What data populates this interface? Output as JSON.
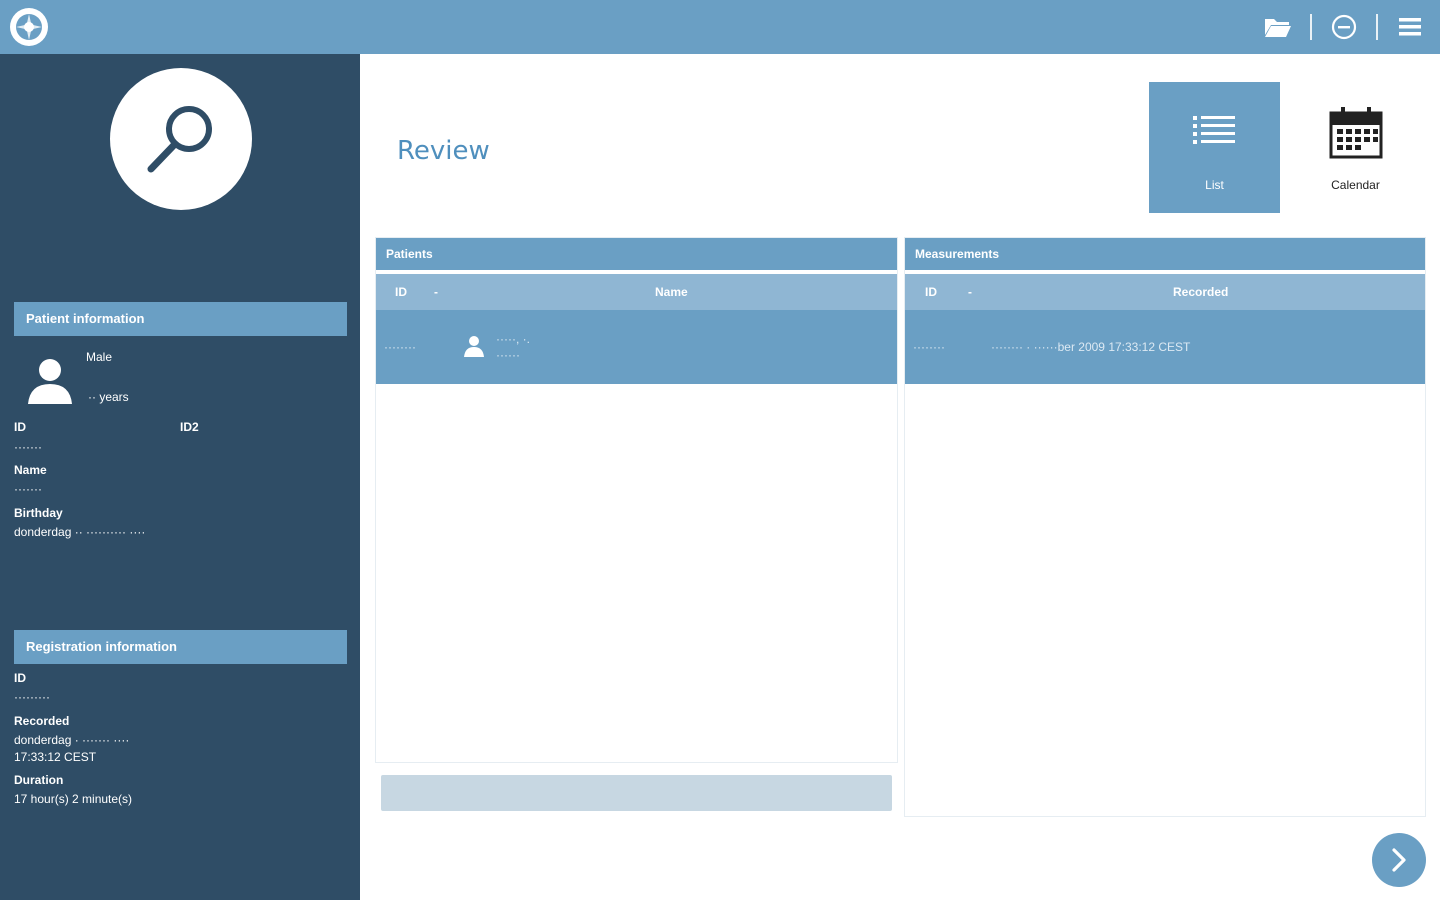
{
  "app": {
    "logo_icon": "app-logo-icon",
    "colors": {
      "accent": "#6a9fc4",
      "sidebar": "#2f4d66",
      "title": "#4f8fbd"
    }
  },
  "topbar": {
    "icons": [
      "folder-open-icon",
      "minus-circle-icon",
      "menu-icon"
    ]
  },
  "sidebar": {
    "mode_icon": "magnifier-icon",
    "patient": {
      "header": "Patient information",
      "sex": "Male",
      "age": "·· years",
      "id_label": "ID",
      "id2_label": "ID2",
      "id_value": "·······",
      "name_label": "Name",
      "name_value": "·······",
      "birthday_label": "Birthday",
      "birthday_value": "donderdag ·· ·········· ····"
    },
    "registration": {
      "header": "Registration information",
      "id_label": "ID",
      "id_value": "·········",
      "recorded_label": "Recorded",
      "recorded_value_line1": "donderdag · ······· ····",
      "recorded_value_line2": "17:33:12 CEST",
      "duration_label": "Duration",
      "duration_value": "17 hour(s) 2 minute(s)"
    }
  },
  "main": {
    "title": "Review",
    "views": [
      {
        "label": "List",
        "icon": "list-icon",
        "active": true
      },
      {
        "label": "Calendar",
        "icon": "calendar-icon",
        "active": false
      }
    ],
    "patients": {
      "title": "Patients",
      "columns": {
        "id": "ID",
        "sort": "-",
        "name": "Name"
      },
      "rows": [
        {
          "id": "········",
          "name_line1": "·····, ·.",
          "name_line2": "······"
        }
      ]
    },
    "measurements": {
      "title": "Measurements",
      "columns": {
        "id": "ID",
        "sort": "-",
        "recorded": "Recorded"
      },
      "rows": [
        {
          "id": "········",
          "recorded": "········ · ······ber 2009 17:33:12 CEST"
        }
      ]
    },
    "next_icon": "chevron-right-icon"
  }
}
